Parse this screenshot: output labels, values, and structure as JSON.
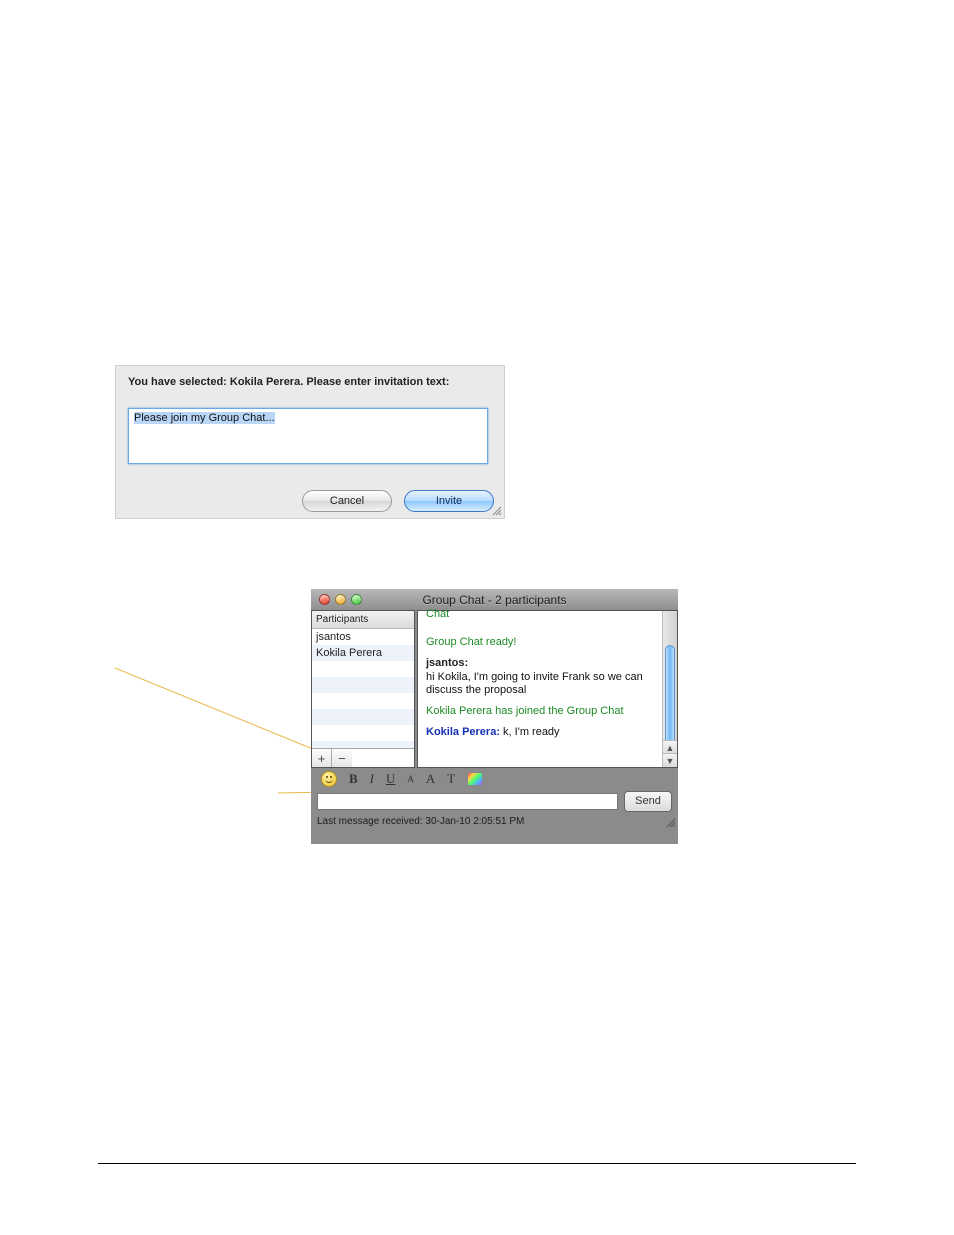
{
  "invite": {
    "prompt": "You have selected: Kokila Perera. Please enter invitation text:",
    "text_value": "Please join my Group Chat...",
    "cancel_label": "Cancel",
    "invite_label": "Invite"
  },
  "chat": {
    "title": "Group Chat - 2 participants",
    "participants_header": "Participants",
    "participants": [
      "jsantos",
      "Kokila Perera"
    ],
    "chat_header": "Chat",
    "messages": {
      "ready": "Group Chat ready!",
      "jsantos_label": "jsantos:",
      "jsantos_body": "hi Kokila, I'm going to invite Frank so we can discuss the proposal",
      "joined": "Kokila Perera has joined the Group Chat",
      "kokila_label": "Kokila Perera:",
      "kokila_body": "k, I'm ready"
    },
    "format": {
      "bold": "B",
      "italic": "I",
      "underline": "U",
      "small": "A",
      "big": "A",
      "font": "T"
    },
    "send_label": "Send",
    "status": "Last message received: 30-Jan-10 2:05:51 PM",
    "plus": "+",
    "minus": "−"
  }
}
